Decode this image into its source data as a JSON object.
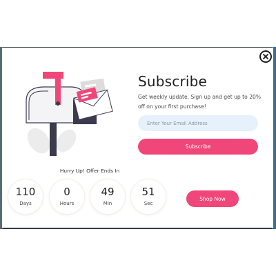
{
  "popup": {
    "title": "Subscribe",
    "description": "Get weekly update. Sign up and get up to 20% off on your first purchase!",
    "email_placeholder": "Enter Your Email Address",
    "subscribe_label": "Subscribe",
    "offer_text": "Hurry Up! Offer Ends In",
    "countdown": [
      {
        "value": "110",
        "unit": "Days"
      },
      {
        "value": "0",
        "unit": "Hours"
      },
      {
        "value": "49",
        "unit": "Min"
      },
      {
        "value": "51",
        "unit": "Sec"
      }
    ],
    "shop_label": "Shop Now",
    "close_icon": "close-icon",
    "illustration_icon": "mailbox-illustration"
  },
  "colors": {
    "accent": "#f0467a",
    "input_bg": "#e6f1fb",
    "backdrop": "#2f3a44"
  }
}
